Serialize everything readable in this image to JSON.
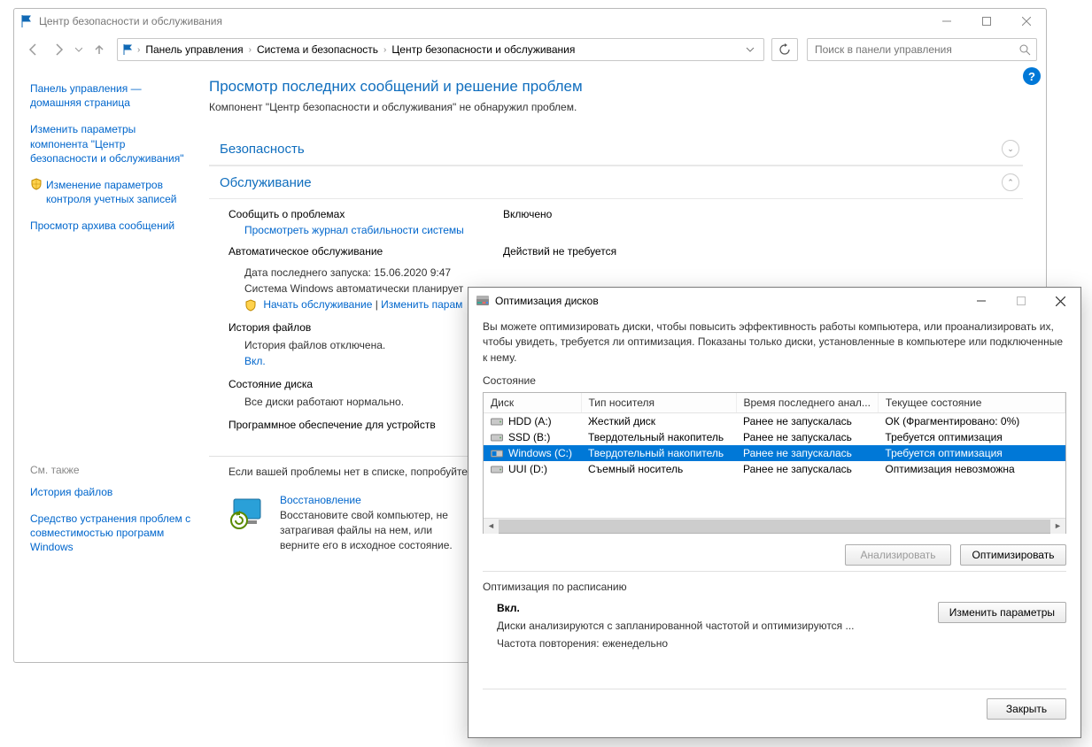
{
  "colors": {
    "accent": "#0078d7",
    "link": "#0066cc"
  },
  "cp": {
    "title": "Центр безопасности и обслуживания",
    "breadcrumb": [
      "Панель управления",
      "Система и безопасность",
      "Центр безопасности и обслуживания"
    ],
    "search_placeholder": "Поиск в панели управления",
    "sidebar": {
      "items": [
        "Панель управления — домашняя страница",
        "Изменить параметры компонента \"Центр безопасности и обслуживания\"",
        "Изменение параметров контроля учетных записей",
        "Просмотр архива сообщений"
      ],
      "see_also_header": "См. также",
      "see_also": [
        "История файлов",
        "Средство устранения проблем с совместимостью программ Windows"
      ]
    },
    "main": {
      "heading": "Просмотр последних сообщений и решение проблем",
      "subheading": "Компонент \"Центр безопасности и обслуживания\" не обнаружил проблем.",
      "sections": {
        "security": {
          "title": "Безопасность"
        },
        "maintenance": {
          "title": "Обслуживание",
          "report_label": "Сообщить о проблемах",
          "report_value": "Включено",
          "stability_link": "Просмотреть журнал стабильности системы",
          "auto_title": "Автоматическое обслуживание",
          "auto_value": "Действий не требуется",
          "last_run": "Дата последнего запуска: 15.06.2020 9:47",
          "auto_text": "Система Windows автоматически планирует",
          "start_link": "Начать обслуживание",
          "change_link": "Изменить парам",
          "history_title": "История файлов",
          "history_text": "История файлов отключена.",
          "history_link": "Вкл.",
          "disk_title": "Состояние диска",
          "disk_text": "Все диски работают нормально.",
          "devsoft_title": "Программное обеспечение для устройств"
        }
      },
      "troubleshoot_text": "Если вашей проблемы нет в списке, попробуйте",
      "recovery": {
        "title": "Восстановление",
        "text": "Восстановите свой компьютер, не затрагивая файлы на нем, или верните его в исходное состояние."
      }
    }
  },
  "opt": {
    "title": "Оптимизация дисков",
    "intro": "Вы можете оптимизировать диски, чтобы повысить эффективность работы  компьютера, или проанализировать их, чтобы увидеть, требуется ли оптимизация. Показаны только диски, установленные в компьютере или подключенные к нему.",
    "status_label": "Состояние",
    "columns": [
      "Диск",
      "Тип носителя",
      "Время последнего анал...",
      "Текущее состояние"
    ],
    "rows": [
      {
        "name": "HDD (A:)",
        "type": "Жесткий диск",
        "last": "Ранее не запускалась",
        "state": "ОК (Фрагментировано: 0%)",
        "icon": "hdd"
      },
      {
        "name": "SSD (B:)",
        "type": "Твердотельный накопитель",
        "last": "Ранее не запускалась",
        "state": "Требуется оптимизация",
        "icon": "hdd"
      },
      {
        "name": "Windows (C:)",
        "type": "Твердотельный накопитель",
        "last": "Ранее не запускалась",
        "state": "Требуется оптимизация",
        "icon": "win",
        "selected": true
      },
      {
        "name": "UUI (D:)",
        "type": "Съемный носитель",
        "last": "Ранее не запускалась",
        "state": "Оптимизация невозможна",
        "icon": "hdd"
      }
    ],
    "buttons": {
      "analyze": "Анализировать",
      "optimize": "Оптимизировать",
      "change": "Изменить параметры",
      "close": "Закрыть"
    },
    "schedule": {
      "header": "Оптимизация по расписанию",
      "on": "Вкл.",
      "line1": "Диски анализируются с запланированной частотой и оптимизируются ...",
      "line2": "Частота повторения: еженедельно"
    }
  }
}
